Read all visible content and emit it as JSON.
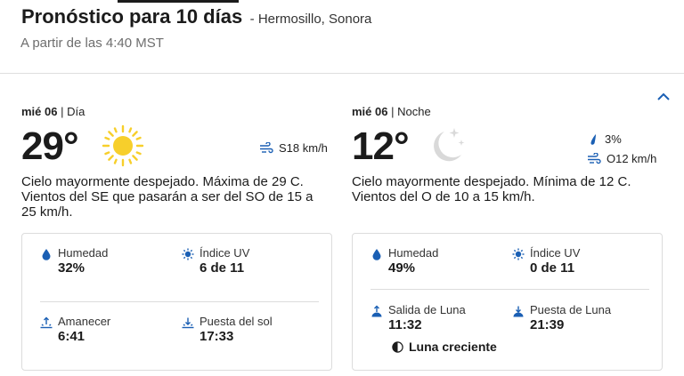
{
  "header": {
    "title": "Pronóstico para 10 días",
    "location": "- Hermosillo, Sonora",
    "updated": "A partir de las 4:40 MST"
  },
  "day": {
    "date": "mié 06",
    "period": "| Día",
    "temp": "29°",
    "wind": "S18 km/h",
    "description": "Cielo mayormente despejado. Máxima de 29 C. Vientos del SE que pasarán a ser del SO de 15 a 25 km/h.",
    "humidity_label": "Humedad",
    "humidity": "32%",
    "uv_label": "Índice UV",
    "uv": "6 de 11",
    "sunrise_label": "Amanecer",
    "sunrise": "6:41",
    "sunset_label": "Puesta del sol",
    "sunset": "17:33"
  },
  "night": {
    "date": "mié 06",
    "period": "| Noche",
    "temp": "12°",
    "precip": "3%",
    "wind": "O12 km/h",
    "description": "Cielo mayormente despejado. Mínima de 12 C. Vientos del O de 10 a 15 km/h.",
    "humidity_label": "Humedad",
    "humidity": "49%",
    "uv_label": "Índice UV",
    "uv": "0 de 11",
    "moonrise_label": "Salida de Luna",
    "moonrise": "11:32",
    "moonset_label": "Puesta de Luna",
    "moonset": "21:39",
    "moon_phase": "Luna creciente"
  },
  "colors": {
    "accent": "#1a5fb4",
    "sun": "#f7cf2b",
    "moon": "#d9d9d9"
  }
}
